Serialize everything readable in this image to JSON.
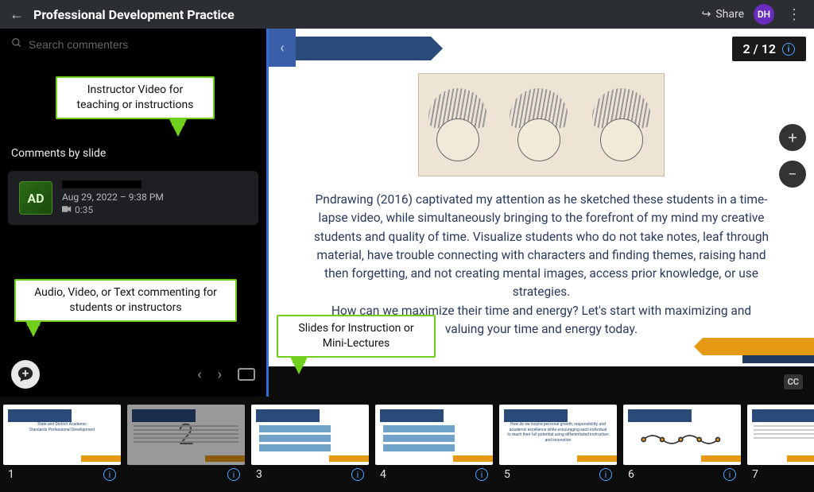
{
  "header": {
    "title": "Professional Development Practice",
    "share_label": "Share",
    "avatar_initials": "DH"
  },
  "search": {
    "placeholder": "Search commenters"
  },
  "callouts": {
    "instructor_video": "Instructor Video for teaching or instructions",
    "commenting": "Audio, Video, or Text commenting for students or instructors",
    "slides": "Slides for Instruction or Mini-Lectures"
  },
  "sidebar": {
    "heading": "Comments by slide",
    "comment": {
      "avatar": "AD",
      "timestamp": "Aug 29, 2022 – 9:38 PM",
      "duration": "0:35"
    }
  },
  "slide": {
    "counter": "2 / 12",
    "body_p1": "Pndrawing (2016) captivated my attention as he sketched these students in a time-lapse video, while simultaneously bringing to the forefront of my mind my creative students and quality of time. Visualize students who do not take notes, leaf through material, have trouble connecting with characters and finding themes, raising hand then forgetting, and not creating mental images, access prior knowledge, or use strategies.",
    "body_p2": "How can we maximize their time and energy? Let's start with maximizing and valuing your time and energy today."
  },
  "thumbnails": [
    {
      "num": "1"
    },
    {
      "num": "2"
    },
    {
      "num": "3"
    },
    {
      "num": "4"
    },
    {
      "num": "5"
    },
    {
      "num": "6"
    },
    {
      "num": "7"
    }
  ],
  "cc_label": "CC"
}
